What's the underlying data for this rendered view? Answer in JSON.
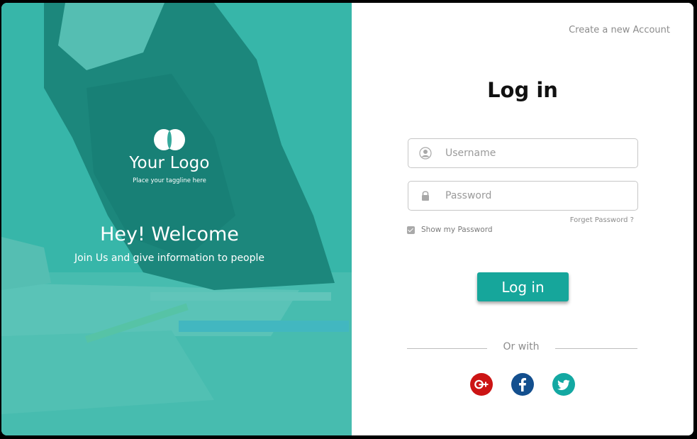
{
  "brand": {
    "logo_name": "Your Logo",
    "tagline": "Place your taggline here"
  },
  "welcome": {
    "title": "Hey! Welcome",
    "subtitle": "Join Us and give information to people"
  },
  "login": {
    "create_account_link": "Create a new Account",
    "title": "Log in",
    "username_placeholder": "Username",
    "password_placeholder": "Password",
    "forgot_password": "Forget Password ?",
    "show_password_label": "Show my Password",
    "show_password_checked": true,
    "submit_label": "Log in",
    "or_with": "Or with"
  },
  "social": [
    {
      "name": "google-plus",
      "icon": "google-plus-icon",
      "glyph": "g+",
      "color": "#cc1414"
    },
    {
      "name": "facebook",
      "icon": "facebook-icon",
      "glyph": "f",
      "color": "#134f8e"
    },
    {
      "name": "twitter",
      "icon": "twitter-icon",
      "glyph": "bird",
      "color": "#13a8a2"
    }
  ],
  "colors": {
    "accent": "#16a69b",
    "left_panel_tint": "#36b4a7"
  }
}
